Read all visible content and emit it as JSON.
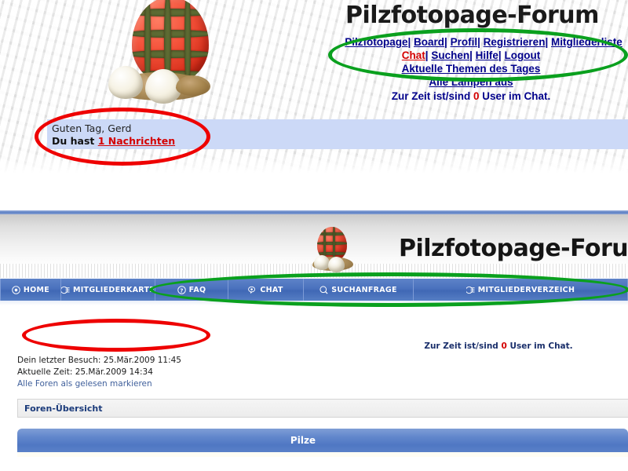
{
  "top": {
    "site_title": "Pilzfotopage-Forum",
    "nav_row1": [
      {
        "label": "Pilzfotopage",
        "color": "blue"
      },
      {
        "label": "Board",
        "color": "blue"
      },
      {
        "label": "Profil",
        "color": "blue"
      },
      {
        "label": "Registrieren",
        "color": "blue"
      },
      {
        "label": "Mitgliederliste",
        "color": "blue"
      }
    ],
    "nav_row2": [
      {
        "label": "Chat",
        "color": "red"
      },
      {
        "label": "Suchen",
        "color": "blue"
      },
      {
        "label": "Hilfe",
        "color": "blue"
      },
      {
        "label": "Logout",
        "color": "blue"
      }
    ],
    "nav_row3": "Aktuelle Themen des Tages",
    "nav_row4": "Alle Lampen aus",
    "separator": "|",
    "chat_status_prefix": "Zur Zeit ist/sind ",
    "chat_status_count": "0",
    "chat_status_suffix": " User im Chat.",
    "greeting_line1": "Guten Tag, Gerd",
    "greeting_prefix": "Du hast ",
    "greeting_link": "1 Nachrichten"
  },
  "bottom": {
    "site_title": "Pilzfotopage-Forum",
    "navbar": [
      {
        "label": "HOME",
        "icon": "home-icon"
      },
      {
        "label": "MITGLIEDERKARTE",
        "icon": "memberlist-icon"
      },
      {
        "label": "FAQ",
        "icon": "question-icon"
      },
      {
        "label": "CHAT",
        "icon": "chat-icon"
      },
      {
        "label": "SUCHANFRAGE",
        "icon": "search-icon"
      },
      {
        "label": "MITGLIEDERVERZEICH",
        "icon": "memberdirectory-icon"
      }
    ],
    "last_visit": "Dein letzter Besuch: 25.Mär.2009 11:45",
    "current_time": "Aktuelle Zeit: 25.Mär.2009 14:34",
    "mark_read_link": "Alle Foren als gelesen markieren",
    "chat_status_prefix": "Zur Zeit ist/sind ",
    "chat_status_count": "0",
    "chat_status_suffix": " User im Chat.",
    "breadcrumb": "Foren-Übersicht",
    "category_title": "Pilze"
  },
  "annotations": {
    "green_ellipse_top_note": "top navigation links",
    "green_ellipse_bottom_note": "bottom navigation bar",
    "red_ellipse_top_note": "greeting / messages block",
    "red_ellipse_bottom_note": "empty region where greeting is missing",
    "green_color": "#0aa01e",
    "red_color": "#ee0000"
  }
}
